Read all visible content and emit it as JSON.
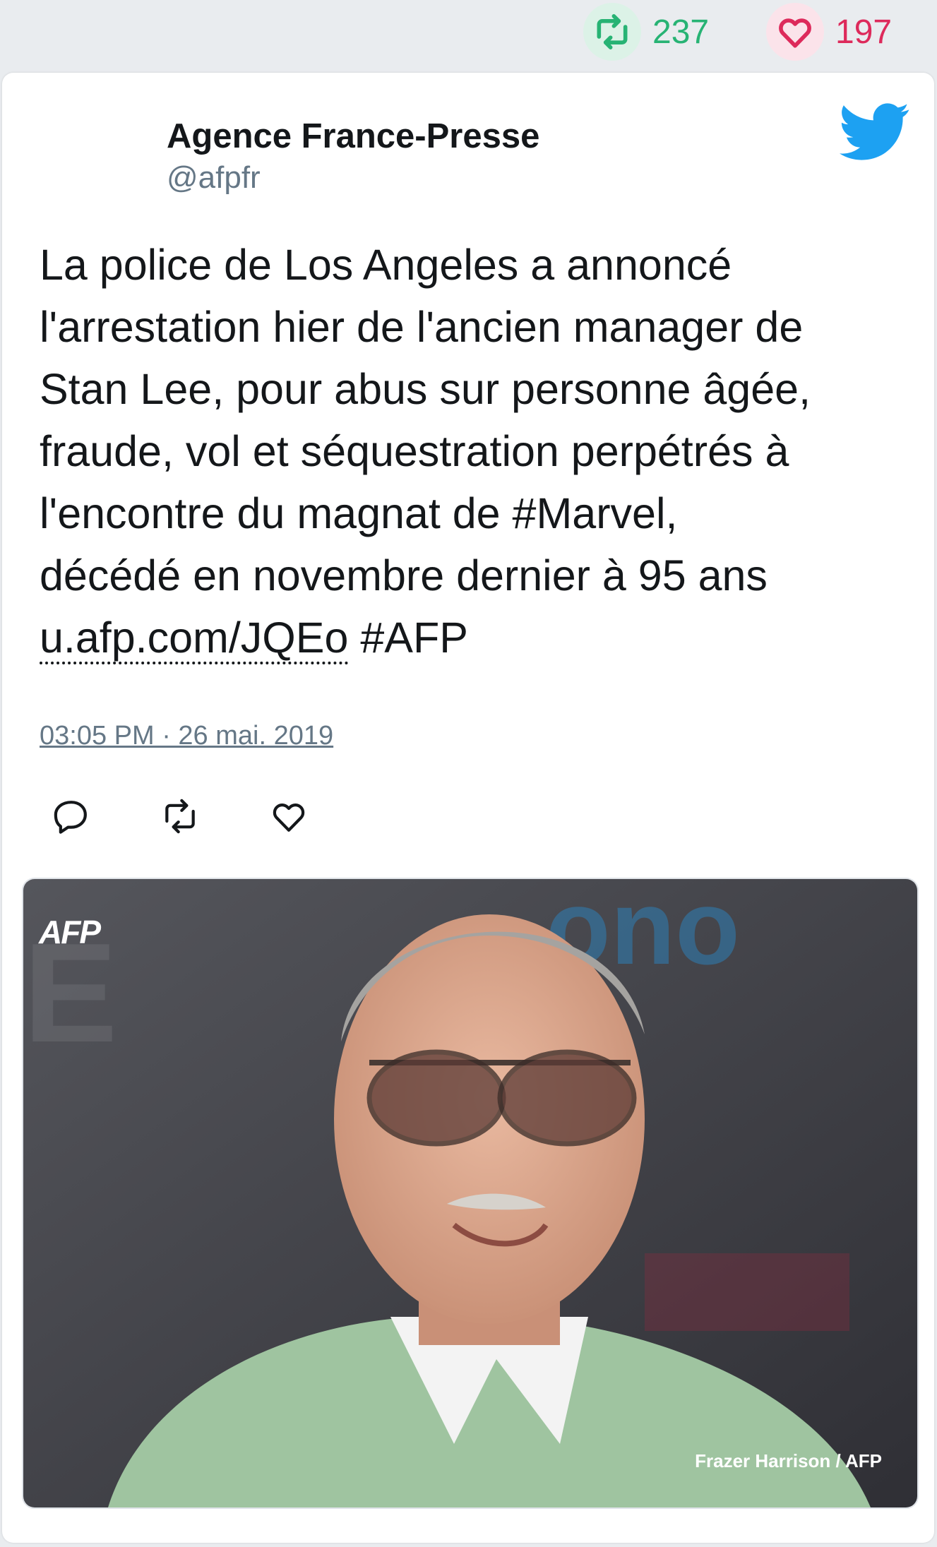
{
  "header_stats": {
    "retweet_icon": "retweet-icon",
    "retweets": "237",
    "like_icon": "heart-icon",
    "likes": "197"
  },
  "tweet": {
    "author_name": "Agence France-Presse",
    "author_handle": "@afpfr",
    "brand_icon": "twitter-bird-icon",
    "text_lines": [
      "La police de Los Angeles a annoncé",
      "l'arrestation hier de l'ancien manager de",
      "Stan Lee, pour abus sur personne âgée,",
      "fraude, vol et séquestration perpétrés à",
      "l'encontre du magnat de #Marvel,",
      "décédé en novembre dernier à 95 ans"
    ],
    "link_text": "u.afp.com/JQEo",
    "trailing_hashtag": "#AFP",
    "timestamp": "03:05 PM · 26 mai. 2019",
    "actions": [
      "reply-icon",
      "retweet-icon",
      "heart-icon"
    ]
  },
  "media": {
    "watermark": "AFP",
    "credit": "Frazer Harrison / AFP"
  },
  "colors": {
    "background": "#e9ecef",
    "retweet_green": "#27b374",
    "like_red": "#dd2a5b",
    "twitter_blue": "#1da1f2",
    "secondary_text": "#657786"
  }
}
